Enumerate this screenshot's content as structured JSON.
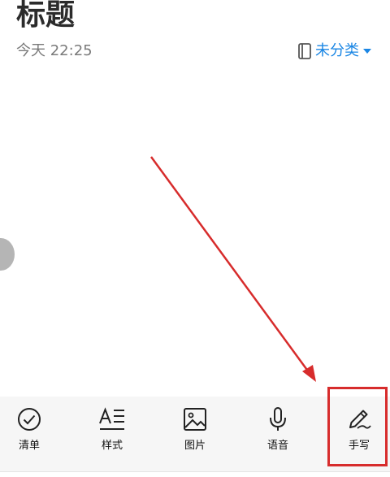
{
  "note": {
    "title": "标题",
    "datetime": "今天 22:25"
  },
  "category": {
    "label": "未分类",
    "icon": "notebook-icon",
    "dropdown_icon": "caret-down-icon",
    "color": "#1a86e4"
  },
  "toolbar": {
    "items": [
      {
        "label": "清单",
        "icon": "checkmark-circle-icon"
      },
      {
        "label": "样式",
        "icon": "text-style-icon"
      },
      {
        "label": "图片",
        "icon": "image-icon"
      },
      {
        "label": "语音",
        "icon": "microphone-icon"
      },
      {
        "label": "手写",
        "icon": "pen-icon"
      }
    ]
  },
  "annotation": {
    "color": "#d72c2c",
    "target": "手写"
  }
}
